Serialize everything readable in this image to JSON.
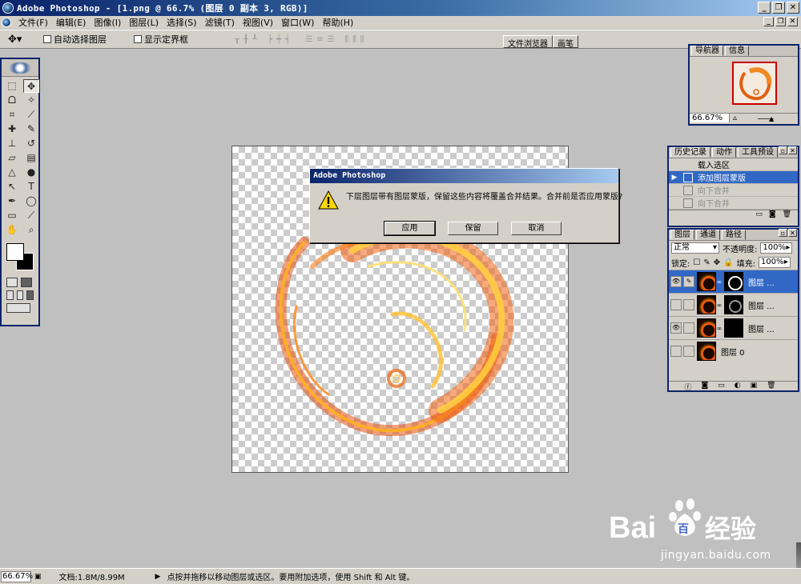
{
  "window": {
    "title": "Adobe Photoshop - [1.png @ 66.7% (图层 0 副本 3, RGB)]"
  },
  "menu": [
    "文件(F)",
    "编辑(E)",
    "图像(I)",
    "图层(L)",
    "选择(S)",
    "滤镜(T)",
    "视图(V)",
    "窗口(W)",
    "帮助(H)"
  ],
  "options": {
    "auto_select": "自动选择图层",
    "show_bounds": "显示定界框"
  },
  "well_tabs": [
    "文件浏览器",
    "画笔"
  ],
  "navigator": {
    "tabs": [
      "导航器",
      "信息"
    ],
    "zoom": "66.67%"
  },
  "history": {
    "tabs": [
      "历史记录",
      "动作",
      "工具预设"
    ],
    "items": [
      {
        "label": "载入选区",
        "state": "normal"
      },
      {
        "label": "添加图层蒙版",
        "state": "active"
      },
      {
        "label": "向下合并",
        "state": "dim"
      },
      {
        "label": "向下合并",
        "state": "dim"
      }
    ]
  },
  "layers": {
    "tabs": [
      "图层",
      "通道",
      "路径"
    ],
    "blend_mode": "正常",
    "opacity_label": "不透明度:",
    "opacity": "100%",
    "lock_label": "锁定:",
    "fill_label": "填充:",
    "fill": "100%",
    "rows": [
      {
        "name": "图层 ...",
        "visible": true,
        "active": true,
        "mask": "light"
      },
      {
        "name": "图层 ...",
        "visible": false,
        "active": false,
        "mask": "gray"
      },
      {
        "name": "图层 ...",
        "visible": true,
        "active": false,
        "mask": "dark"
      },
      {
        "name": "图层 0",
        "visible": false,
        "active": false,
        "mask": "none"
      }
    ]
  },
  "dialog": {
    "title": "Adobe Photoshop",
    "message": "下层图层带有图层蒙版，保留这些内容将覆盖合并结果。合并前是否应用蒙版?",
    "buttons": {
      "apply": "应用",
      "preserve": "保留",
      "cancel": "取消"
    }
  },
  "status": {
    "zoom": "66.67%",
    "doc": "文档:1.8M/8.99M",
    "tip": "点按并拖移以移动图层或选区。要用附加选项，使用 Shift 和 Alt 键。"
  },
  "watermark": {
    "brand": "Bai",
    "brand2": "百",
    "brand_cn": "经验",
    "url": "jingyan.baidu.com"
  },
  "colors": {
    "titlebar": "#0a246a",
    "selection": "#3168c5",
    "chrome": "#d4d0c8",
    "workspace": "#c0c0c0"
  }
}
